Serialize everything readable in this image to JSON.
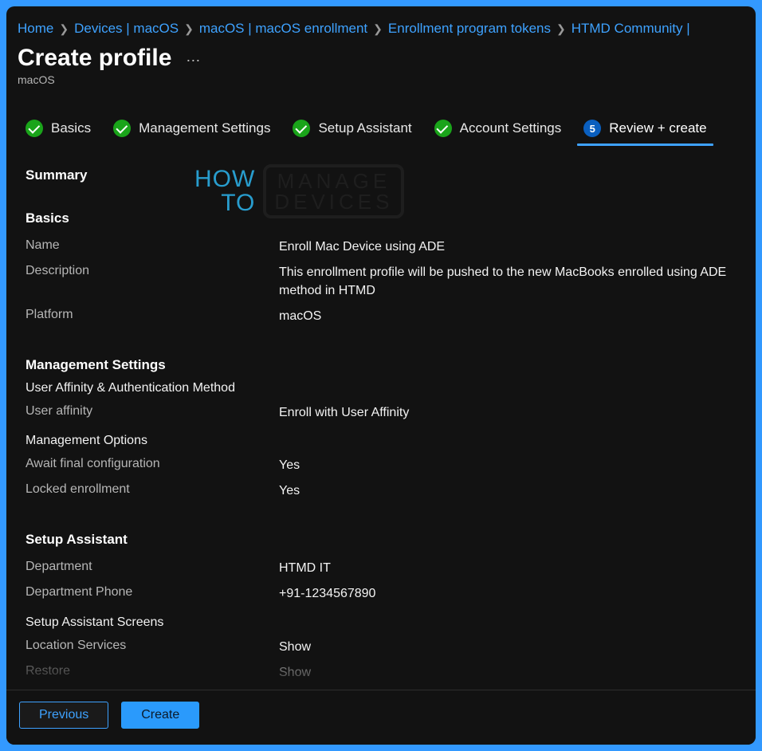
{
  "breadcrumb": {
    "items": [
      {
        "label": "Home"
      },
      {
        "label": "Devices | macOS"
      },
      {
        "label": "macOS | macOS enrollment"
      },
      {
        "label": "Enrollment program tokens"
      },
      {
        "label": "HTMD Community | "
      }
    ]
  },
  "header": {
    "title": "Create profile",
    "subtitle": "macOS"
  },
  "stepper": {
    "steps": [
      {
        "label": "Basics",
        "state": "done"
      },
      {
        "label": "Management Settings",
        "state": "done"
      },
      {
        "label": "Setup Assistant",
        "state": "done"
      },
      {
        "label": "Account Settings",
        "state": "done"
      },
      {
        "label": "Review + create",
        "number": "5",
        "state": "current"
      }
    ]
  },
  "summary": {
    "heading": "Summary",
    "basics": {
      "heading": "Basics",
      "name_label": "Name",
      "name_value": "Enroll Mac Device using ADE",
      "description_label": "Description",
      "description_value": "This enrollment profile will be pushed to the new MacBooks enrolled using ADE\nmethod in HTMD",
      "platform_label": "Platform",
      "platform_value": "macOS"
    },
    "management": {
      "heading": "Management Settings",
      "affinity_heading": "User Affinity & Authentication Method",
      "user_affinity_label": "User affinity",
      "user_affinity_value": "Enroll with User Affinity",
      "options_heading": "Management Options",
      "await_label": "Await final configuration",
      "await_value": "Yes",
      "locked_label": "Locked enrollment",
      "locked_value": "Yes"
    },
    "setup": {
      "heading": "Setup Assistant",
      "department_label": "Department",
      "department_value": "HTMD IT",
      "phone_label": "Department Phone",
      "phone_value": "+91-1234567890",
      "screens_heading": "Setup Assistant Screens",
      "location_label": "Location Services",
      "location_value": "Show",
      "restore_label": "Restore",
      "restore_value": "Show"
    }
  },
  "footer": {
    "previous": "Previous",
    "create": "Create"
  },
  "watermark": {
    "l1": "HOW",
    "l2": "TO",
    "r1": "MANAGE",
    "r2": "DEVICES"
  }
}
